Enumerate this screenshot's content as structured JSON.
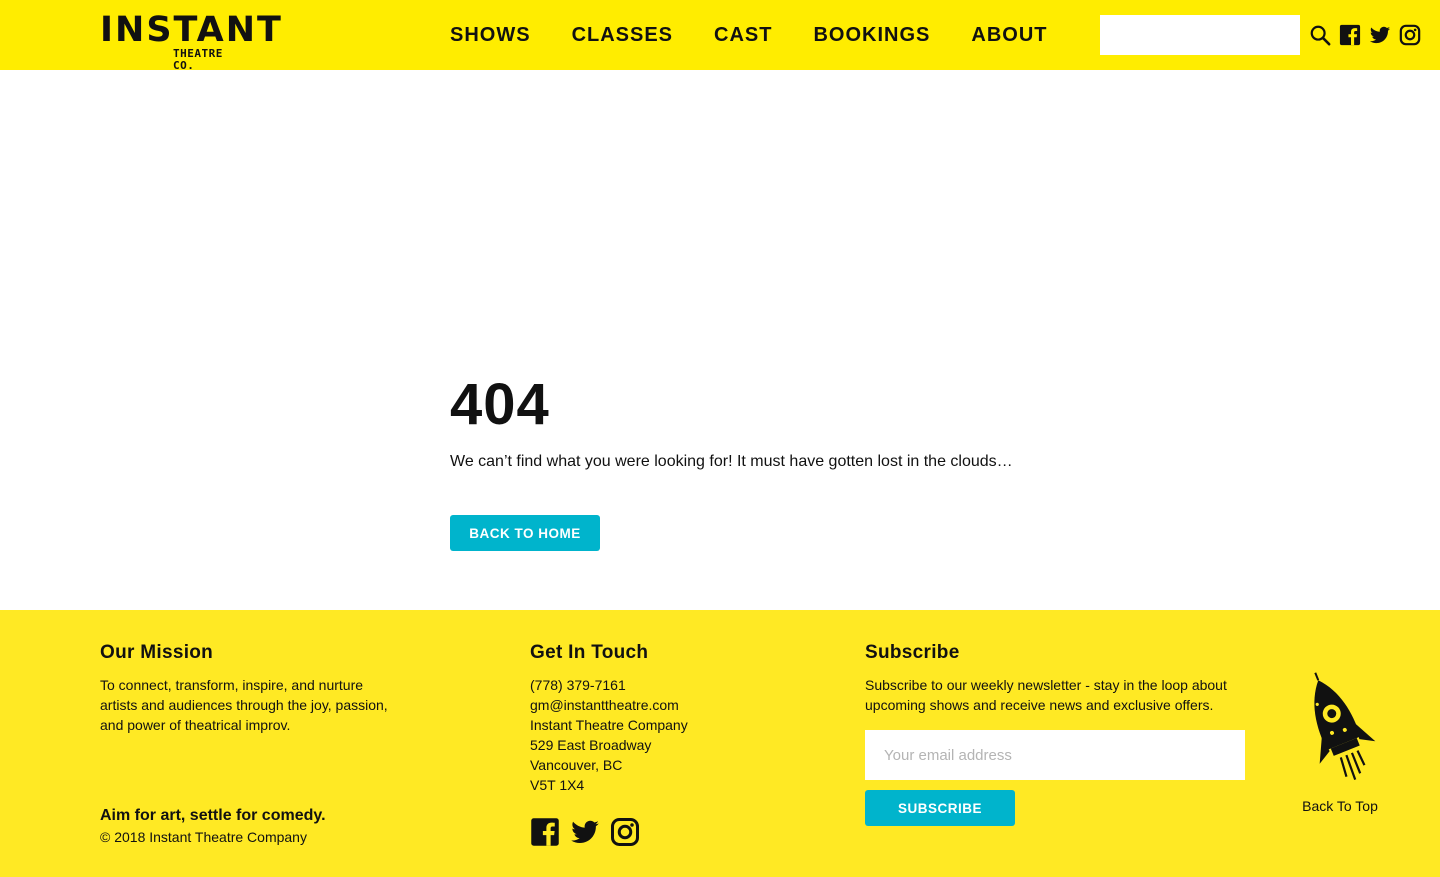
{
  "brand": {
    "logo_word": "INSTANT",
    "logo_sub": "THEATRE CO."
  },
  "nav": {
    "items": [
      {
        "label": "SHOWS"
      },
      {
        "label": "CLASSES"
      },
      {
        "label": "CAST"
      },
      {
        "label": "BOOKINGS"
      },
      {
        "label": "ABOUT"
      }
    ]
  },
  "header": {
    "search_value": "",
    "icons": [
      "search-icon",
      "facebook-icon",
      "twitter-icon",
      "instagram-icon"
    ]
  },
  "error": {
    "code": "404",
    "message": "We can’t find what you were looking for! It must have gotten lost in the clouds…",
    "button_label": "BACK TO HOME"
  },
  "footer": {
    "mission": {
      "title": "Our Mission",
      "text": "To connect, transform, inspire, and nurture artists and audiences through the joy, passion, and power of theatrical improv."
    },
    "tagline": "Aim for art, settle for comedy.",
    "copyright": "© 2018 Instant Theatre Company",
    "contact": {
      "title": "Get In Touch",
      "lines": [
        "(778) 379-7161",
        "gm@instanttheatre.com",
        "Instant Theatre Company",
        "529 East Broadway",
        "Vancouver, BC",
        "V5T 1X4"
      ]
    },
    "subscribe": {
      "title": "Subscribe",
      "text": "Subscribe to our weekly newsletter - stay in the loop about upcoming shows and receive news and exclusive offers.",
      "email_placeholder": "Your email address",
      "button_label": "SUBSCRIBE"
    },
    "back_to_top": "Back To Top"
  },
  "colors": {
    "header_yellow": "#ffed00",
    "footer_yellow": "#ffe924",
    "accent_teal": "#00b4cc",
    "text": "#111111"
  }
}
